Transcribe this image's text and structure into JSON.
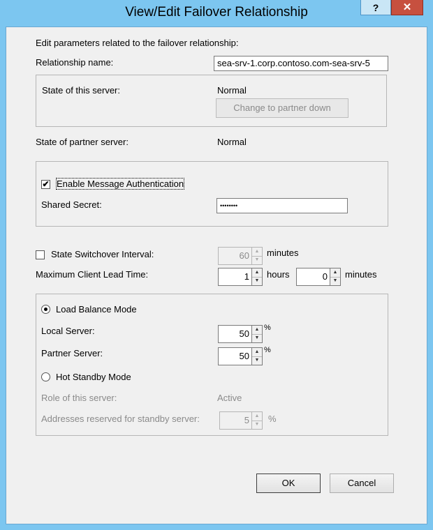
{
  "window": {
    "title": "View/Edit Failover Relationship",
    "help_glyph": "?",
    "close_glyph": "✕"
  },
  "intro": "Edit parameters related to the failover relationship:",
  "relationship": {
    "label": "Relationship name:",
    "value": "sea-srv-1.corp.contoso.com-sea-srv-5"
  },
  "this_server": {
    "label": "State of this server:",
    "value": "Normal",
    "button_label": "Change to partner down"
  },
  "partner_server": {
    "label": "State of partner server:",
    "value": "Normal"
  },
  "auth": {
    "checkbox_label": "Enable Message Authentication",
    "checked": true,
    "secret_label": "Shared Secret:",
    "secret_value": "••••••••"
  },
  "switchover": {
    "checkbox_label": "State Switchover Interval:",
    "checked": false,
    "value": "60",
    "unit": "minutes"
  },
  "mclt": {
    "label": "Maximum Client Lead Time:",
    "hours_value": "1",
    "hours_unit": "hours",
    "minutes_value": "0",
    "minutes_unit": "minutes"
  },
  "mode": {
    "load_balance_label": "Load Balance Mode",
    "load_balance_selected": true,
    "local_label": "Local Server:",
    "local_value": "50",
    "partner_label": "Partner Server:",
    "partner_value": "50",
    "percent": "%",
    "hot_standby_label": "Hot Standby Mode",
    "hot_standby_selected": false,
    "role_label": "Role of this server:",
    "role_value": "Active",
    "reserved_label": "Addresses reserved for standby server:",
    "reserved_value": "5"
  },
  "buttons": {
    "ok": "OK",
    "cancel": "Cancel"
  },
  "colors": {
    "frame": "#7cc6f0",
    "close": "#c7503f"
  }
}
